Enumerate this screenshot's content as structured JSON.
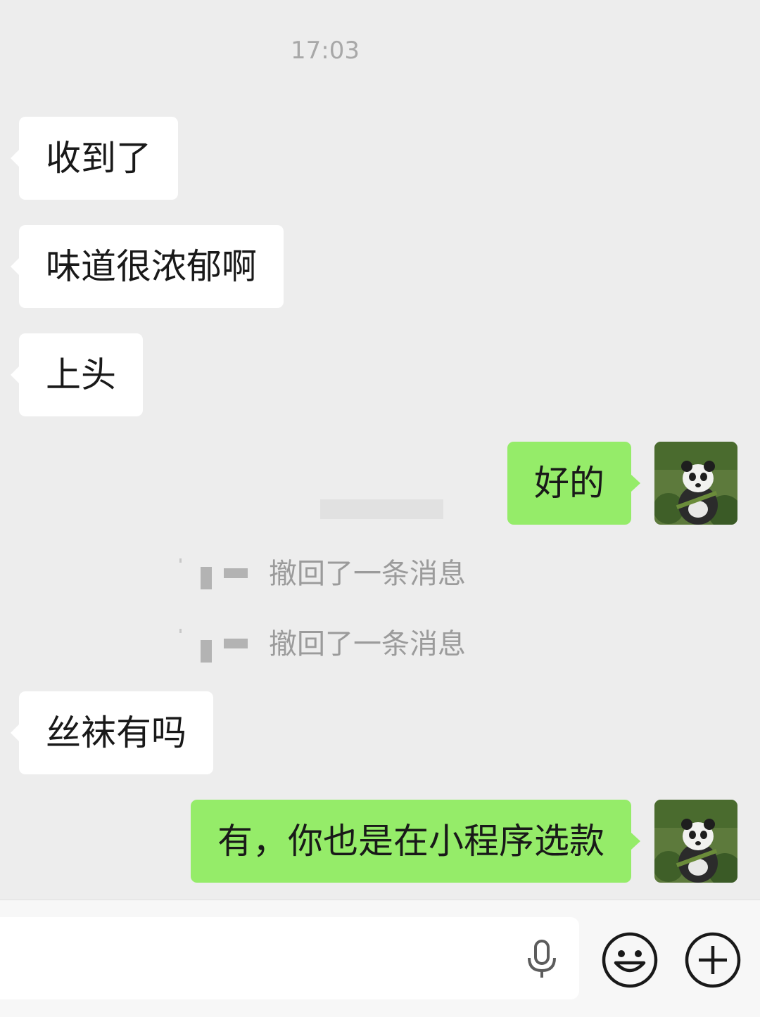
{
  "chat": {
    "timestamp": "17:03",
    "messages": [
      {
        "side": "in",
        "text": "收到了"
      },
      {
        "side": "in",
        "text": "味道很浓郁啊"
      },
      {
        "side": "in",
        "text": "上头"
      },
      {
        "side": "out",
        "text": "好的"
      },
      {
        "side": "out",
        "text": "有，你也是在小程序选款"
      },
      {
        "side": "in",
        "text": "丝袜有吗"
      }
    ],
    "recall_notices": [
      {
        "text": "撤回了一条消息"
      },
      {
        "text": "撤回了一条消息"
      }
    ]
  },
  "input_bar": {
    "icons": [
      "microphone-icon",
      "emoji-icon",
      "plus-icon"
    ]
  },
  "colors": {
    "background": "#ededed",
    "incoming_bubble": "#ffffff",
    "outgoing_bubble": "#95ec69"
  }
}
